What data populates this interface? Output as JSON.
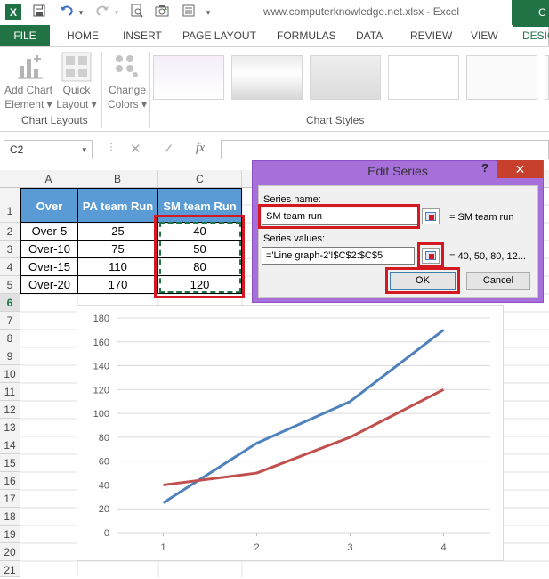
{
  "titlebar": {
    "app_icon": "X",
    "doc_title": "www.computerknowledge.net.xlsx - Excel",
    "user_initial": "C",
    "icons": [
      "excel-logo-icon",
      "save-icon",
      "undo-icon",
      "redo-icon",
      "print-preview-icon",
      "camera-icon",
      "form-icon",
      "customize-dropdown-icon"
    ]
  },
  "tabs": {
    "file": "FILE",
    "items": [
      "HOME",
      "INSERT",
      "PAGE LAYOUT",
      "FORMULAS",
      "DATA",
      "REVIEW",
      "VIEW"
    ],
    "active": "DESIG"
  },
  "ribbon": {
    "add_chart_1": "Add Chart",
    "add_chart_2": "Element",
    "quick_layout_1": "Quick",
    "quick_layout_2": "Layout",
    "change_colors_1": "Change",
    "change_colors_2": "Colors",
    "group_layouts": "Chart Layouts",
    "group_styles": "Chart Styles"
  },
  "formula_bar": {
    "name_box": "C2",
    "fx": "fx",
    "cancel": "✕",
    "confirm": "✓"
  },
  "sheet": {
    "columns": [
      "A",
      "B",
      "C"
    ],
    "rows": [
      "1",
      "2",
      "3",
      "4",
      "5",
      "6",
      "7",
      "8",
      "9",
      "10",
      "11",
      "12",
      "13",
      "14",
      "15",
      "16",
      "17",
      "18",
      "19",
      "20",
      "21"
    ],
    "headers": [
      "Over",
      "PA team Run",
      "SM team Run"
    ],
    "data": [
      [
        "Over-5",
        "25",
        "40"
      ],
      [
        "Over-10",
        "75",
        "50"
      ],
      [
        "Over-15",
        "110",
        "80"
      ],
      [
        "Over-20",
        "170",
        "120"
      ]
    ]
  },
  "dialog": {
    "title": "Edit Series",
    "help": "?",
    "close": "✕",
    "series_name_label": "Series name:",
    "series_name_value": "SM team run",
    "series_name_preview": "= SM team run",
    "series_values_label": "Series values:",
    "series_values_value": "='Line graph-2'!$C$2:$C$5",
    "series_values_preview": "= 40, 50, 80, 12...",
    "ok": "OK",
    "cancel": "Cancel"
  },
  "chart_data": {
    "type": "line",
    "x": [
      1,
      2,
      3,
      4
    ],
    "ylim": [
      0,
      180
    ],
    "yticks": [
      0,
      20,
      40,
      60,
      80,
      100,
      120,
      140,
      160,
      180
    ],
    "grid": true,
    "series": [
      {
        "values": [
          25,
          75,
          110,
          170
        ],
        "color": "#4f81bd"
      },
      {
        "values": [
          40,
          50,
          80,
          120
        ],
        "color": "#c0504d"
      }
    ]
  },
  "colors": {
    "excel_green": "#217346",
    "header_blue": "#5b9bd5",
    "highlight_red": "#d51923",
    "dialog_purple": "#a66fd9"
  }
}
